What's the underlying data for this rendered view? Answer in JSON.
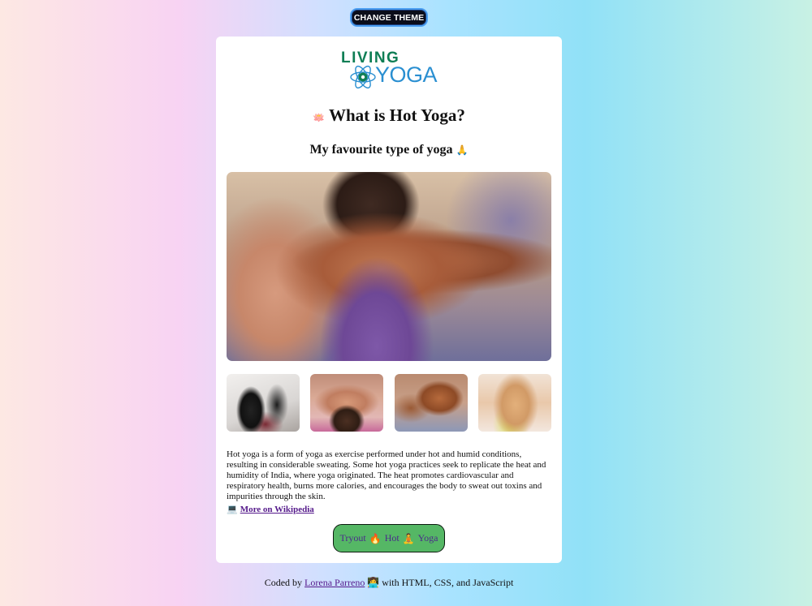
{
  "theme_button": {
    "label": "CHANGE THEME"
  },
  "logo": {
    "line1": "LIVING",
    "line2": "YOGA"
  },
  "header": {
    "title_icon": "🪷",
    "title": "What is Hot Yoga?",
    "subtitle": "My favourite type of yoga",
    "subtitle_icon": "🙏"
  },
  "images": {
    "hero": "hot-yoga-hero-photo",
    "thumbnails": [
      "yoga-class-thumbnail",
      "yoga-pose-thumbnail",
      "downward-dog-thumbnail",
      "yoga-stretch-thumbnail"
    ]
  },
  "description": "Hot yoga is a form of yoga as exercise performed under hot and humid conditions, resulting in considerable sweating. Some hot yoga practices seek to replicate the heat and humidity of India, where yoga originated. The heat promotes cardiovascular and respiratory health, burns more calories, and encourages the body to sweat out toxins and impurities through the skin.",
  "wiki_link": {
    "icon": "💻",
    "label": "More on Wikipedia"
  },
  "tryout_button": {
    "word1": "Tryout",
    "icon1": "🔥",
    "word2": "Hot",
    "icon2": "🧘",
    "word3": "Yoga"
  },
  "footer": {
    "prefix": "Coded by",
    "author": "Lorena Parreno",
    "author_icon": "👩‍💻",
    "suffix": "with HTML, CSS, and JavaScript"
  },
  "colors": {
    "brand_green": "#0f7e55",
    "brand_blue": "#2a8fd1",
    "button_green": "#55b765",
    "theme_button_bg": "#0b0d1a"
  }
}
